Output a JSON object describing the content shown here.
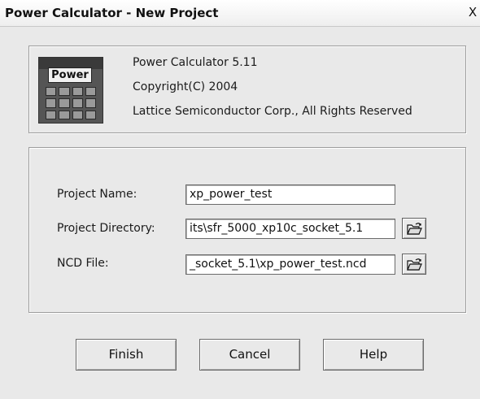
{
  "window": {
    "title": "Power Calculator - New Project",
    "close_glyph": "X"
  },
  "about": {
    "logo_text": "Power",
    "product": "Power Calculator 5.11",
    "copyright": "Copyright(C) 2004",
    "company": "Lattice Semiconductor Corp., All Rights Reserved"
  },
  "form": {
    "project_name": {
      "label": "Project Name:",
      "value": "xp_power_test"
    },
    "project_directory": {
      "label": "Project Directory:",
      "value": "its\\sfr_5000_xp10c_socket_5.1"
    },
    "ncd_file": {
      "label": "NCD File:",
      "value": "_socket_5.1\\xp_power_test.ncd"
    }
  },
  "buttons": {
    "finish": "Finish",
    "cancel": "Cancel",
    "help": "Help"
  },
  "icons": {
    "browse": "open-folder-icon",
    "close": "close-icon"
  }
}
